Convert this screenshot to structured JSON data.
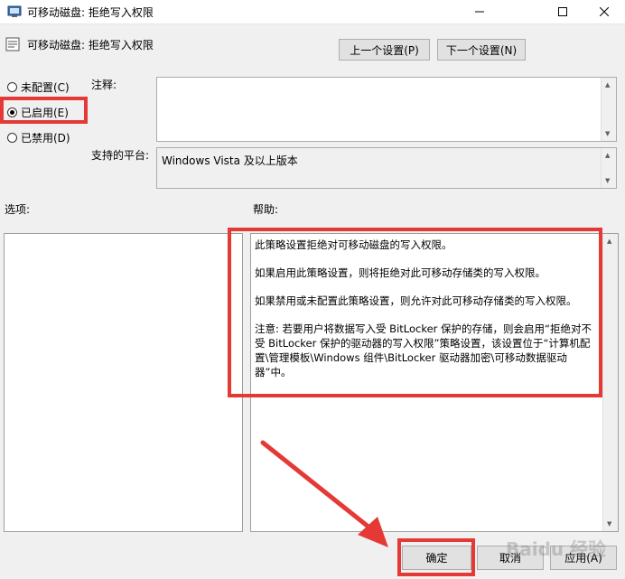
{
  "window": {
    "title": "可移动磁盘: 拒绝写入权限"
  },
  "header": {
    "title": "可移动磁盘: 拒绝写入权限"
  },
  "nav": {
    "prev_label": "上一个设置(P)",
    "next_label": "下一个设置(N)"
  },
  "options": [
    {
      "label": "未配置(C)",
      "checked": false
    },
    {
      "label": "已启用(E)",
      "checked": true
    },
    {
      "label": "已禁用(D)",
      "checked": false
    }
  ],
  "comment": {
    "label": "注释:",
    "value": ""
  },
  "platform": {
    "label": "支持的平台:",
    "value": "Windows Vista 及以上版本"
  },
  "options_section_label": "选项:",
  "help_section_label": "帮助:",
  "help": {
    "p1": "此策略设置拒绝对可移动磁盘的写入权限。",
    "p2": "如果启用此策略设置，则将拒绝对此可移动存储类的写入权限。",
    "p3": "如果禁用或未配置此策略设置，则允许对此可移动存储类的写入权限。",
    "p4": "注意: 若要用户将数据写入受 BitLocker 保护的存储，则会启用“拒绝对不受 BitLocker 保护的驱动器的写入权限”策略设置，该设置位于“计算机配置\\管理模板\\Windows 组件\\BitLocker 驱动器加密\\可移动数据驱动器”中。"
  },
  "footer": {
    "ok_label": "确定",
    "cancel_label": "取消",
    "apply_label": "应用(A)"
  },
  "watermark": "Baidu 经验",
  "colors": {
    "highlight": "#e53935",
    "arrow": "#e53935"
  }
}
